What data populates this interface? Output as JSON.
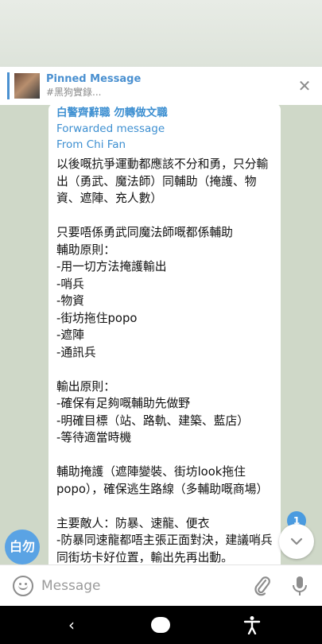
{
  "pinned": {
    "title": "Pinned Message",
    "subtitle": "#黑狗實錄..."
  },
  "message": {
    "header_line": "白警齊辭職 勿轉做文職",
    "forwarded_label": "Forwarded message",
    "from_line": "From Chi Fan",
    "body": "以後嘅抗爭運動都應該不分和勇，只分輸出（勇武、魔法師）同輔助（掩護、物資、遮陣、充人數）\n\n只要唔係勇武同魔法師嘅都係輔助\n輔助原則：\n-用一切方法掩護輸出\n-哨兵\n-物資\n-街坊拖住popo\n-遮陣\n-通訊兵\n\n輸出原則：\n-確保有足夠嘅輔助先做野\n-明確目標（站、路軌、建築、藍店）\n-等待適當時機\n\n輔助掩護（遮陣變裝、街坊look拖住popo），確保逃生路線（多輔助嘅商場）\n\n主要敵人：防暴、速龍、便衣\n-防暴同速龍都唔主張正面對決，建議哨兵同街坊卡好位置，輸出先再出動。\n-便衣嘅話，夠人就遮陣，唔夠人就應"
  },
  "avatar_text": "白勿",
  "unread_badge": "1",
  "composer": {
    "placeholder": "Message"
  },
  "icons": {
    "close": "close-icon",
    "emoji": "emoji-icon",
    "attach": "paperclip-icon",
    "mic": "microphone-icon",
    "scroll_down": "chevron-down-icon",
    "nav_back": "back-icon",
    "nav_home": "home-icon",
    "accessibility": "accessibility-icon"
  },
  "colors": {
    "accent": "#4a90d0",
    "link_blue": "#3d8fd1",
    "avatar_bg": "#5aa3e4",
    "chat_bg": "#cfd8c8"
  }
}
